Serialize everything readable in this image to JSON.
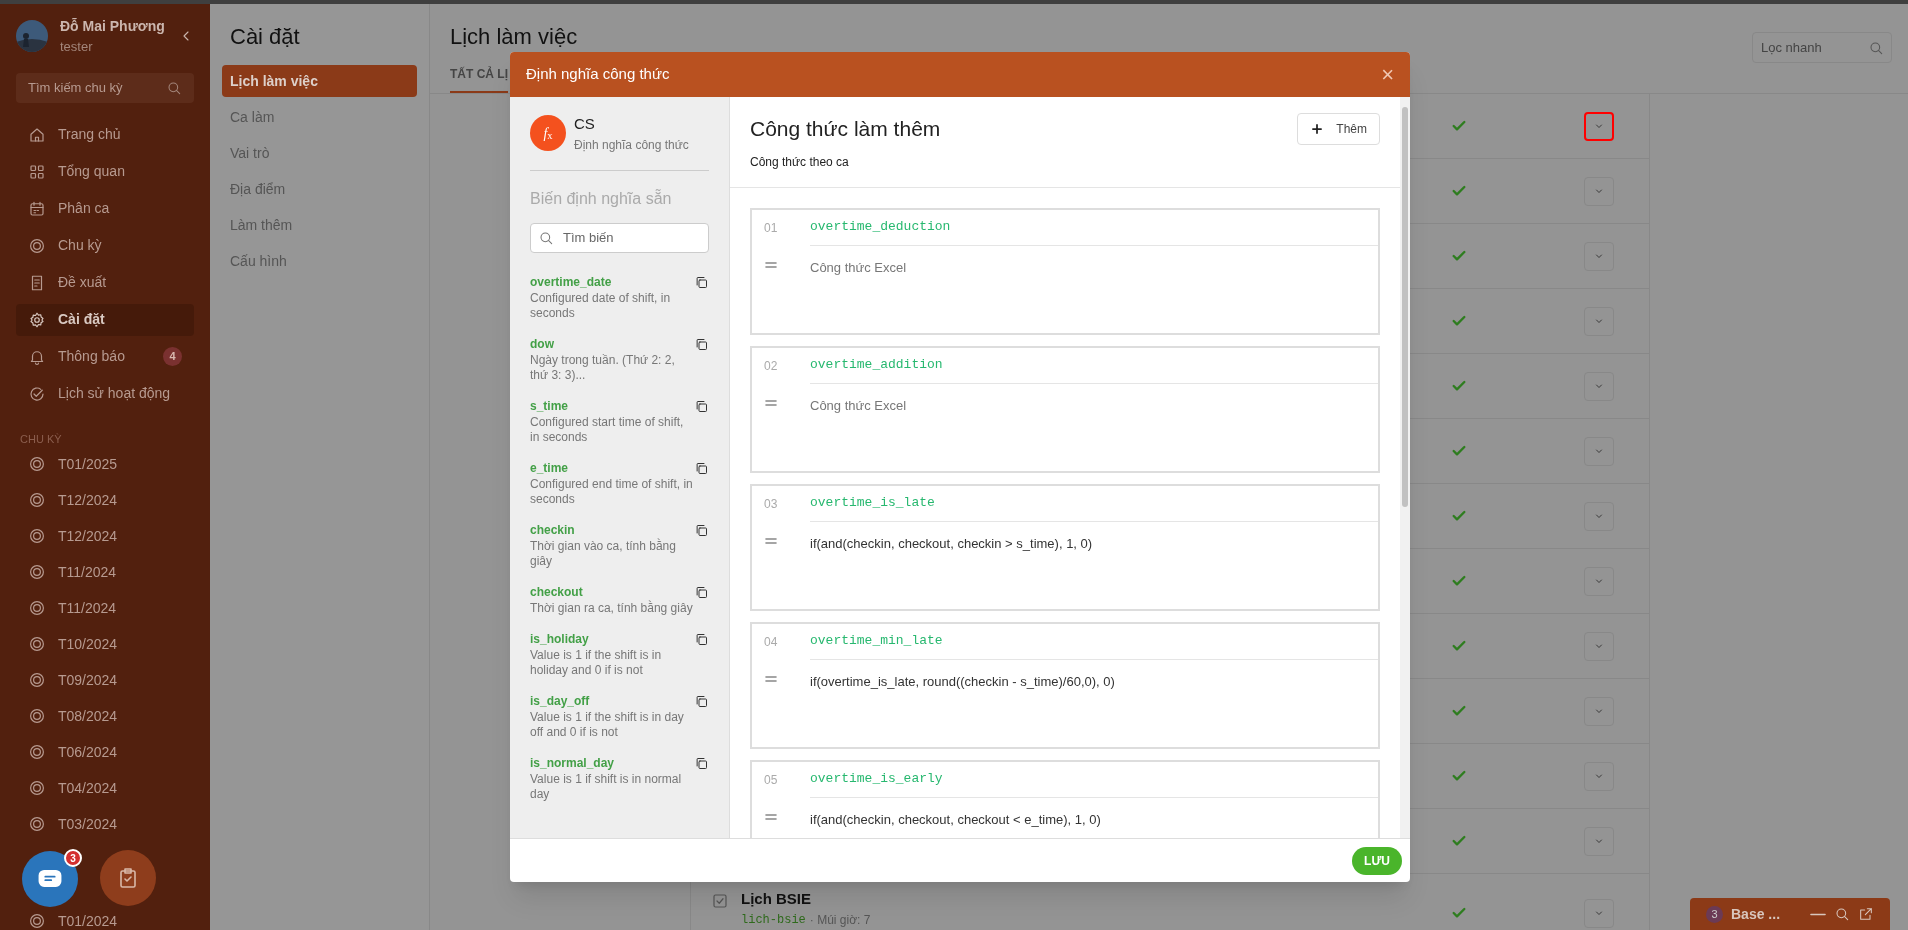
{
  "sidebar": {
    "user": {
      "name": "Đỗ Mai Phương",
      "role": "tester"
    },
    "search": {
      "placeholder": "Tìm kiếm chu kỳ"
    },
    "nav": [
      {
        "kind": "home",
        "label": "Trang chủ",
        "selected": false
      },
      {
        "kind": "grid",
        "label": "Tổng quan",
        "selected": false
      },
      {
        "kind": "calendar",
        "label": "Phân ca",
        "selected": false
      },
      {
        "kind": "cycle",
        "label": "Chu kỳ",
        "selected": false
      },
      {
        "kind": "doc",
        "label": "Đề xuất",
        "selected": false
      },
      {
        "kind": "gear",
        "label": "Cài đặt",
        "selected": true
      },
      {
        "kind": "bell",
        "label": "Thông báo",
        "selected": false,
        "badge": "4"
      },
      {
        "kind": "check",
        "label": "Lịch sử hoạt động",
        "selected": false
      }
    ],
    "section_title": "CHU KỲ",
    "cycles": [
      {
        "kind": "item",
        "label": "T01/2025"
      },
      {
        "kind": "item",
        "label": "T12/2024"
      },
      {
        "kind": "item",
        "label": "T12/2024"
      },
      {
        "kind": "item",
        "label": "T11/2024"
      },
      {
        "kind": "item",
        "label": "T11/2024"
      },
      {
        "kind": "item",
        "label": "T10/2024"
      },
      {
        "kind": "item",
        "label": "T09/2024"
      },
      {
        "kind": "item",
        "label": "T08/2024"
      },
      {
        "kind": "item",
        "label": "T06/2024"
      },
      {
        "kind": "item",
        "label": "T04/2024"
      },
      {
        "kind": "item",
        "label": "T03/2024"
      },
      {
        "kind": "covered"
      },
      {
        "kind": "item",
        "label": "T01/2024"
      }
    ]
  },
  "settings_menu": {
    "title": "Cài đặt",
    "items": [
      {
        "label": "Lịch làm việc",
        "selected": true
      },
      {
        "label": "Ca làm",
        "selected": false
      },
      {
        "label": "Vai trò",
        "selected": false
      },
      {
        "label": "Địa điểm",
        "selected": false
      },
      {
        "label": "Làm thêm",
        "selected": false
      },
      {
        "label": "Cấu hình",
        "selected": false
      }
    ]
  },
  "page": {
    "title": "Lịch làm việc",
    "tabs": [
      {
        "label": "TẤT CẢ LỊ",
        "selected": true
      }
    ],
    "filter": {
      "placeholder": "Lọc nhanh"
    },
    "rows": [
      {
        "enabled": true,
        "highlighted": true
      },
      {
        "enabled": true,
        "highlighted": false
      },
      {
        "enabled": true,
        "highlighted": false
      },
      {
        "enabled": true,
        "highlighted": false
      },
      {
        "enabled": true,
        "highlighted": false
      },
      {
        "enabled": true,
        "highlighted": false
      },
      {
        "enabled": true,
        "highlighted": false
      },
      {
        "enabled": true,
        "highlighted": false
      },
      {
        "enabled": true,
        "highlighted": false
      },
      {
        "enabled": true,
        "highlighted": false
      },
      {
        "enabled": true,
        "highlighted": false
      },
      {
        "enabled": true,
        "highlighted": false
      },
      {
        "enabled": true,
        "highlighted": false,
        "title": "Lịch BSIE",
        "slug": "lich-bsie",
        "meta": "· Múi giờ: 7"
      }
    ]
  },
  "modal": {
    "title": "Định nghĩa công thức",
    "close": "×",
    "left": {
      "avatar": "*f*$_{x}$",
      "name": "CS",
      "subtitle": "Định nghĩa công thức",
      "section": "Biến định nghĩa sẵn",
      "search": {
        "placeholder": "Tìm biến"
      },
      "variables": [
        {
          "name": "overtime_date",
          "description": "Configured date of shift, in seconds"
        },
        {
          "name": "dow",
          "description": "Ngày trong tuần. (Thứ 2: 2, thứ 3: 3)..."
        },
        {
          "name": "s_time",
          "description": "Configured start time of shift, in seconds"
        },
        {
          "name": "e_time",
          "description": "Configured end time of shift, in seconds"
        },
        {
          "name": "checkin",
          "description": "Thời gian vào ca, tính bằng giây"
        },
        {
          "name": "checkout",
          "description": "Thời gian ra ca, tính bằng giây"
        },
        {
          "name": "is_holiday",
          "description": "Value is 1 if the shift is in holiday and 0 if is not"
        },
        {
          "name": "is_day_off",
          "description": "Value is 1 if the shift is in day off and 0 if is not"
        },
        {
          "name": "is_normal_day",
          "description": "Value is 1 if shift is in normal day"
        }
      ]
    },
    "right": {
      "title": "Công thức làm thêm",
      "subtitle": "Công thức theo ca",
      "add_button": "Thêm",
      "formulas": [
        {
          "number": "01",
          "name": "overtime_deduction",
          "placeholder": "Công thức Excel"
        },
        {
          "number": "02",
          "name": "overtime_addition",
          "placeholder": "Công thức Excel"
        },
        {
          "number": "03",
          "name": "overtime_is_late",
          "value": "if(and(checkin, checkout, checkin > s_time), 1, 0)"
        },
        {
          "number": "04",
          "name": "overtime_min_late",
          "value": "if(overtime_is_late, round((checkin - s_time)/60,0), 0)"
        },
        {
          "number": "05",
          "name": "overtime_is_early",
          "value": "if(and(checkin, checkout, checkout < e_time), 1, 0)"
        }
      ]
    },
    "save_button": "LƯU"
  },
  "chat_badge": "3",
  "widget": {
    "badge": "3",
    "title": "Base ..."
  }
}
